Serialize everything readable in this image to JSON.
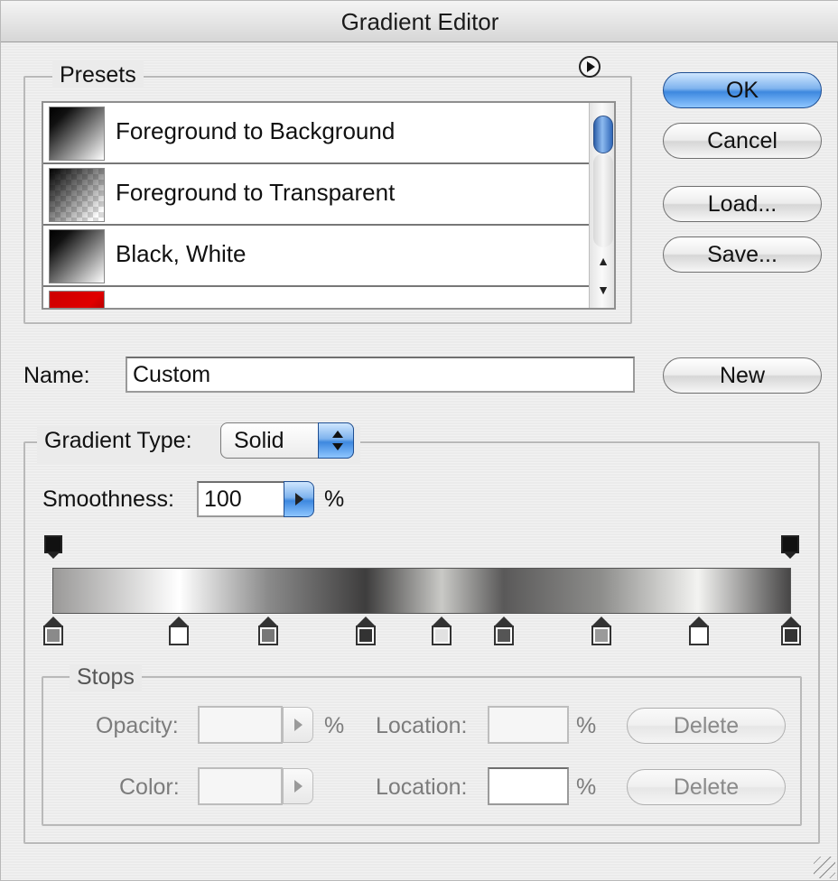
{
  "window": {
    "title": "Gradient Editor"
  },
  "presets": {
    "legend": "Presets",
    "items": [
      {
        "label": "Foreground to Background"
      },
      {
        "label": "Foreground to Transparent"
      },
      {
        "label": "Black, White"
      },
      {
        "label": ""
      }
    ]
  },
  "buttons": {
    "ok": "OK",
    "cancel": "Cancel",
    "load": "Load...",
    "save": "Save...",
    "new": "New"
  },
  "name": {
    "label": "Name:",
    "value": "Custom"
  },
  "gradient": {
    "type_label": "Gradient Type:",
    "type_value": "Solid",
    "smoothness_label": "Smoothness:",
    "smoothness_value": "100",
    "smoothness_unit": "%",
    "colors": [
      "#9a9998",
      "#ffffff",
      "#8a8a8a",
      "#3e3d3d",
      "#c9c9c6",
      "#5a5959",
      "#8d8d8b",
      "#f3f3f1",
      "#474646"
    ],
    "color_stops": [
      {
        "location_pct": 0,
        "fill": "#8a8a8a"
      },
      {
        "location_pct": 17.1,
        "fill": "#ffffff"
      },
      {
        "location_pct": 29.2,
        "fill": "#777777"
      },
      {
        "location_pct": 42.4,
        "fill": "#333333"
      },
      {
        "location_pct": 52.7,
        "fill": "#e2e2e2"
      },
      {
        "location_pct": 61.1,
        "fill": "#555555"
      },
      {
        "location_pct": 74.3,
        "fill": "#9a9a9a"
      },
      {
        "location_pct": 87.5,
        "fill": "#ffffff"
      },
      {
        "location_pct": 100,
        "fill": "#333333"
      }
    ],
    "opacity_stops": [
      {
        "location_pct": 0
      },
      {
        "location_pct": 100
      }
    ]
  },
  "stops": {
    "legend": "Stops",
    "opacity_label": "Opacity:",
    "opacity_unit": "%",
    "opacity_location_label": "Location:",
    "opacity_location_unit": "%",
    "opacity_delete": "Delete",
    "color_label": "Color:",
    "color_location_label": "Location:",
    "color_location_unit": "%",
    "color_delete": "Delete"
  },
  "colors": {
    "accent": "#3d88df",
    "dialog_bg": "#ebebeb"
  }
}
